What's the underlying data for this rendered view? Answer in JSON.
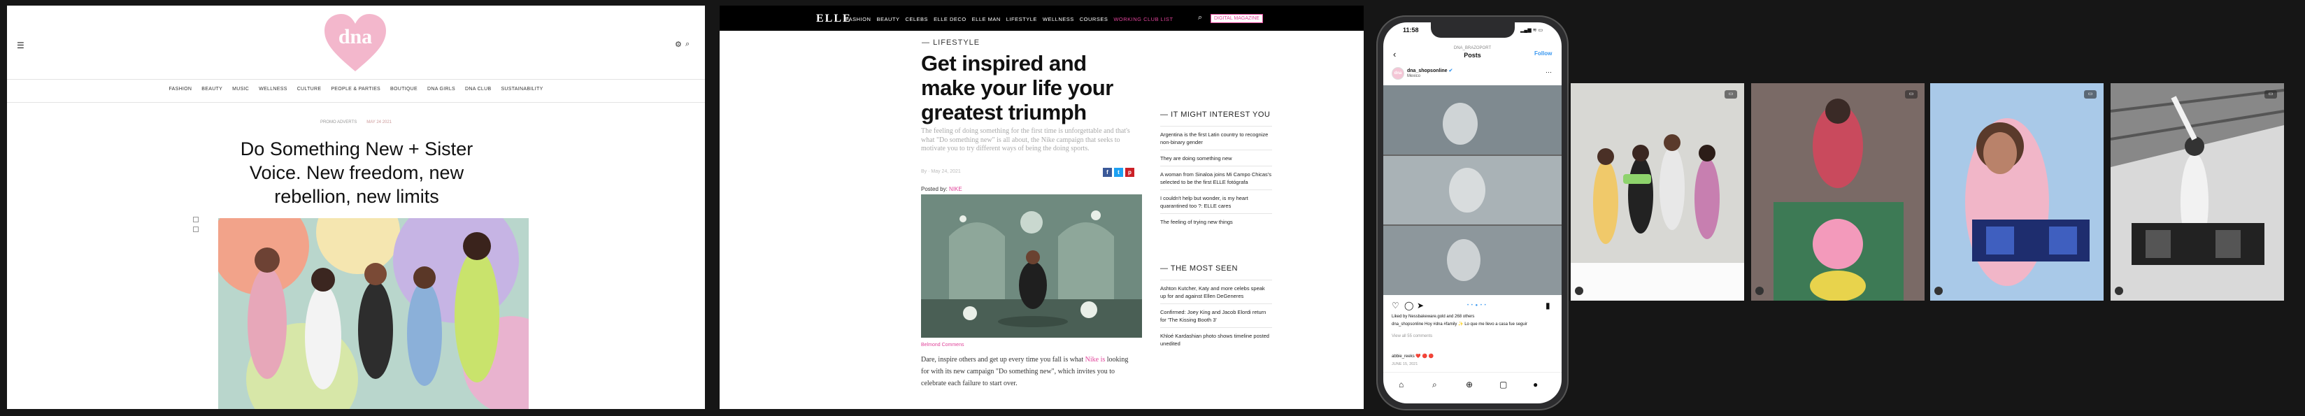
{
  "dna_site": {
    "logo_text": "dna",
    "nav": [
      "FASHION",
      "BEAUTY",
      "MUSIC",
      "WELLNESS",
      "CULTURE",
      "PEOPLE & PARTIES",
      "BOUTIQUE",
      "DNA GIRLS",
      "DNA CLUB",
      "SUSTAINABILITY"
    ],
    "meta_category": "PROMO ADVERTS",
    "meta_date": "MAY 24 2021",
    "title": "Do Something New + Sister Voice. New freedom, new rebellion, new limits"
  },
  "elle_site": {
    "brand": "ELLE",
    "menu": [
      "FASHION",
      "BEAUTY",
      "CELEBS",
      "ELLE DECO",
      "ELLE MAN",
      "LIFESTYLE",
      "WELLNESS",
      "COURSES"
    ],
    "menu_highlight": "WORKING CLUB LIST",
    "register_label": "DIGITAL MAGAZINE",
    "section": "LIFESTYLE",
    "headline": "Get inspired and make your life your greatest triumph",
    "lead": "The feeling of doing something for the first time is unforgettable and that's what \"Do something new\" is all about, the Nike campaign that seeks to motivate you to try different ways of being the doing sports.",
    "byline": "By  ·  May 24, 2021",
    "posted_prefix": "Posted by:",
    "posted_by": "NIKE",
    "image_credit": "Belmond Commens",
    "body_prefix": "Dare, inspire others and get up every time you fall is what ",
    "body_link": "Nike is",
    "body_suffix": " looking for with its new campaign \"Do something new\", which invites you to celebrate each failure to start over.",
    "interest_heading": "IT MIGHT INTEREST YOU",
    "interest_items": [
      "Argentina is the first Latin country to recognize non-binary gender",
      "They are doing something new",
      "A woman from Sinaloa joins Mi Campo Chicas's selected to be the first ELLE fotógrafa",
      "I couldn't help but wonder, is my heart quarantined too ?: ELLE cares",
      "The feeling of trying new things"
    ],
    "seen_heading": "THE MOST SEEN",
    "seen_items": [
      "Ashton Kutcher, Katy and more celebs speak up for and against Ellen DeGeneres",
      "Confirmed: Joey King and Jacob Elordi return for 'The Kissing Booth 3'",
      "Khloé Kardashian photo shows timeline posted unedited"
    ],
    "social": [
      {
        "icon": "facebook-icon",
        "glyph": "f",
        "color": "#3b5998"
      },
      {
        "icon": "twitter-icon",
        "glyph": "t",
        "color": "#1da1f2"
      },
      {
        "icon": "pinterest-icon",
        "glyph": "p",
        "color": "#cb2027"
      }
    ]
  },
  "phone": {
    "time": "11:58",
    "status": "▂▄▆ ≋ ▭",
    "account_top": "DNA_BRAZOPORT",
    "page_title": "Posts",
    "follow": "Follow",
    "avatar_text": "dna",
    "username": "dna_shopsonline",
    "verified": "✔",
    "location": "Mexico",
    "pager": "• • ● • •",
    "likes": "Liked by Nessbakeware.gold and 268 others",
    "caption": "dna_shopsonline Hoy #dna #family ✨ Lo que me llevo a casa fue seguir",
    "comments": "View all 55 comments",
    "comment_user": "abbie_reeks ❤️  🔴  🔴",
    "when": "JUNE 15, 2021"
  },
  "thumbs": [
    {
      "badge": "▭"
    },
    {
      "badge": "▭"
    },
    {
      "badge": "▭"
    },
    {
      "badge": "▭"
    }
  ]
}
